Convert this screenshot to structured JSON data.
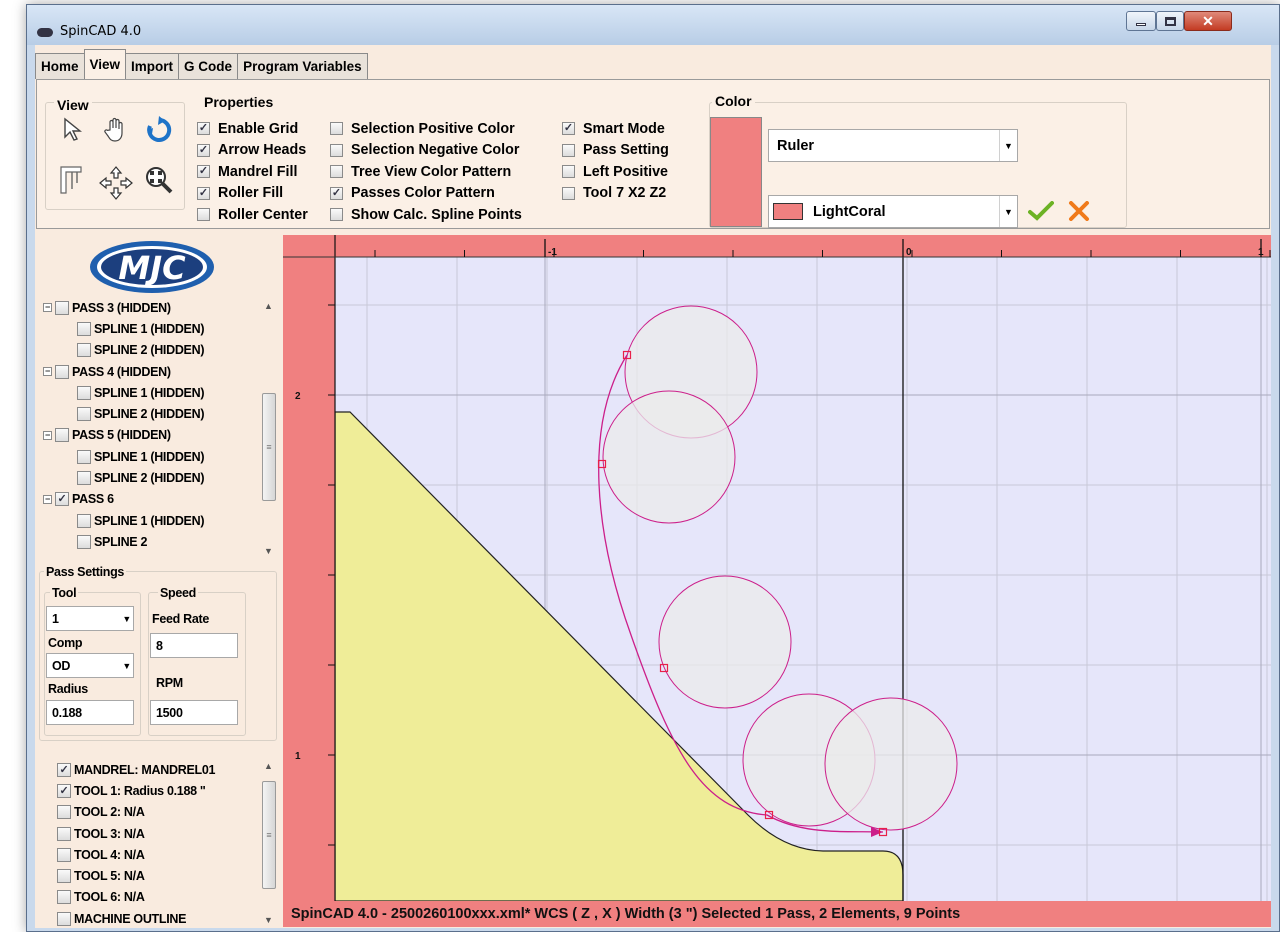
{
  "window": {
    "title": "SpinCAD 4.0"
  },
  "tabs": [
    "Home",
    "View",
    "Import",
    "G Code",
    "Program Variables"
  ],
  "ribbon": {
    "view_group": {
      "title": "View"
    },
    "properties_group": {
      "title": "Properties",
      "col1": [
        {
          "label": "Enable Grid",
          "checked": true
        },
        {
          "label": "Arrow Heads",
          "checked": true
        },
        {
          "label": "Mandrel Fill",
          "checked": true
        },
        {
          "label": "Roller Fill",
          "checked": true
        },
        {
          "label": "Roller Center",
          "checked": false
        }
      ],
      "col2": [
        {
          "label": "Selection Positive Color",
          "checked": false
        },
        {
          "label": "Selection Negative Color",
          "checked": false
        },
        {
          "label": "Tree View Color Pattern",
          "checked": false
        },
        {
          "label": "Passes Color Pattern",
          "checked": true
        },
        {
          "label": "Show Calc. Spline Points",
          "checked": false
        }
      ],
      "col3": [
        {
          "label": "Smart Mode",
          "checked": true
        },
        {
          "label": "Pass Setting",
          "checked": false
        },
        {
          "label": "Left Positive",
          "checked": false
        },
        {
          "label": "Tool 7 X2 Z2",
          "checked": false
        }
      ]
    },
    "color_group": {
      "title": "Color",
      "target": "Ruler",
      "color_name": "LightCoral",
      "swatch_color": "#f08080"
    }
  },
  "tree_passes": [
    {
      "label": "PASS 3 (HIDDEN)",
      "level": 0,
      "checked": false
    },
    {
      "label": "SPLINE 1 (HIDDEN)",
      "level": 1,
      "checked": false
    },
    {
      "label": "SPLINE 2 (HIDDEN)",
      "level": 1,
      "checked": false
    },
    {
      "label": "PASS 4 (HIDDEN)",
      "level": 0,
      "checked": false
    },
    {
      "label": "SPLINE 1 (HIDDEN)",
      "level": 1,
      "checked": false
    },
    {
      "label": "SPLINE 2 (HIDDEN)",
      "level": 1,
      "checked": false
    },
    {
      "label": "PASS 5 (HIDDEN)",
      "level": 0,
      "checked": false
    },
    {
      "label": "SPLINE 1 (HIDDEN)",
      "level": 1,
      "checked": false
    },
    {
      "label": "SPLINE 2 (HIDDEN)",
      "level": 1,
      "checked": false
    },
    {
      "label": "PASS 6",
      "level": 0,
      "checked": true
    },
    {
      "label": "SPLINE 1 (HIDDEN)",
      "level": 1,
      "checked": false
    },
    {
      "label": "SPLINE 2",
      "level": 1,
      "checked": false
    }
  ],
  "pass_settings": {
    "title": "Pass Settings",
    "tool_group": "Tool",
    "tool_value": "1",
    "comp_label": "Comp",
    "comp_value": "OD",
    "radius_label": "Radius",
    "radius_value": "0.188",
    "speed_group": "Speed",
    "feed_label": "Feed Rate",
    "feed_value": "8",
    "rpm_label": "RPM",
    "rpm_value": "1500"
  },
  "tree_tools": [
    {
      "label": "MANDREL: MANDREL01",
      "checked": true
    },
    {
      "label": "TOOL 1: Radius 0.188 \"",
      "checked": true
    },
    {
      "label": "TOOL 2: N/A",
      "checked": false
    },
    {
      "label": "TOOL 3: N/A",
      "checked": false
    },
    {
      "label": "TOOL 4: N/A",
      "checked": false
    },
    {
      "label": "TOOL 5: N/A",
      "checked": false
    },
    {
      "label": "TOOL 6: N/A",
      "checked": false
    },
    {
      "label": "MACHINE OUTLINE",
      "checked": false
    }
  ],
  "canvas": {
    "x_labels": [
      "-1",
      "0",
      "1"
    ],
    "y_labels": [
      "2",
      "1"
    ],
    "ruler_color": "#f08080",
    "background_color": "#e6e6fa",
    "mandrel_color": "#efed98",
    "path_color": "#cc1f8a"
  },
  "status": "SpinCAD 4.0 - 2500260100xxx.xml*  WCS ( Z , X )  Width (3 \")  Selected 1 Pass, 2 Elements, 9 Points"
}
